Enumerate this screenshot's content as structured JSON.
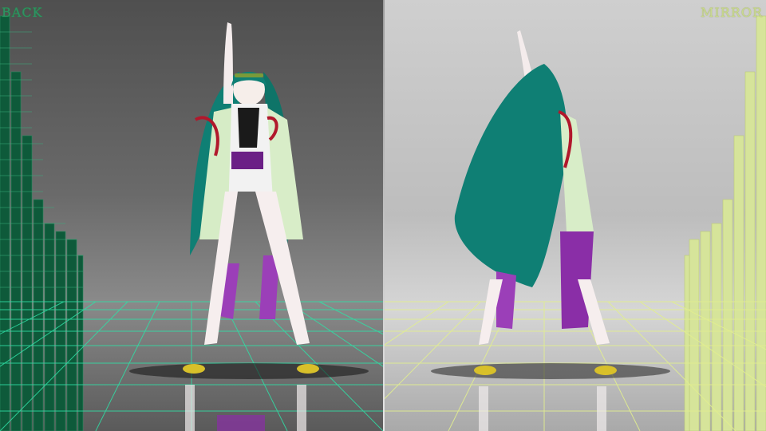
{
  "viewport": {
    "left_label": "BACK",
    "right_label": "MIRROR"
  },
  "colors": {
    "left_grid": "#2fe0a6",
    "right_grid": "#e2ef8f",
    "left_eq": "#0e5a3a",
    "right_eq": "#d6e49a",
    "hair": "#0f7f74",
    "sash": "#6b1f86"
  },
  "scene": {
    "figure_left": "character-front-view",
    "figure_right": "character-back-view"
  }
}
